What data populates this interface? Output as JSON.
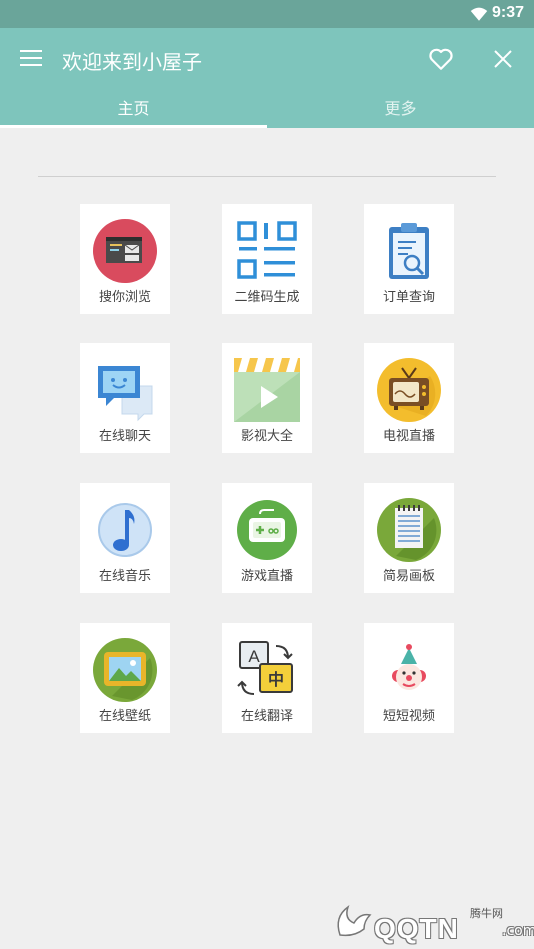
{
  "status_bar": {
    "time": "9:37"
  },
  "appbar": {
    "title": "欢迎来到小屋子"
  },
  "tabs": [
    {
      "label": "主页"
    },
    {
      "label": "更多"
    }
  ],
  "grid": [
    {
      "label": "搜你浏览",
      "icon": "browser-icon"
    },
    {
      "label": "二维码生成",
      "icon": "qrcode-icon"
    },
    {
      "label": "订单查询",
      "icon": "order-search-icon"
    },
    {
      "label": "在线聊天",
      "icon": "chat-icon"
    },
    {
      "label": "影视大全",
      "icon": "video-icon"
    },
    {
      "label": "电视直播",
      "icon": "tv-icon"
    },
    {
      "label": "在线音乐",
      "icon": "music-icon"
    },
    {
      "label": "游戏直播",
      "icon": "gamepad-icon"
    },
    {
      "label": "简易画板",
      "icon": "notepad-icon"
    },
    {
      "label": "在线壁纸",
      "icon": "wallpaper-icon"
    },
    {
      "label": "在线翻译",
      "icon": "translate-icon"
    },
    {
      "label": "短短视频",
      "icon": "clown-icon"
    }
  ],
  "watermark": {
    "site": "腾牛网",
    "brand": "QQTN",
    "suffix": ".com"
  },
  "colors": {
    "appbar": "#7ec5bc",
    "status_bar": "#6aa59a",
    "background": "#efefef"
  }
}
